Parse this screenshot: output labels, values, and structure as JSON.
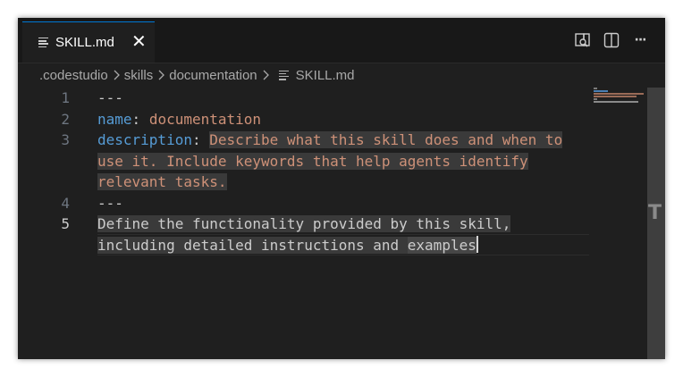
{
  "tab": {
    "label": "SKILL.md",
    "close_glyph": "✕",
    "icon": "markdown-file-icon"
  },
  "actions": [
    {
      "name": "open-preview-icon"
    },
    {
      "name": "split-editor-icon"
    },
    {
      "name": "more-actions-icon",
      "glyph": "···"
    }
  ],
  "breadcrumb": {
    "items": [
      ".codestudio",
      "skills",
      "documentation",
      "SKILL.md"
    ],
    "separator": ">"
  },
  "editor": {
    "line_numbers": [
      "1",
      "2",
      "3",
      "4",
      "5"
    ],
    "active_line": "5",
    "lines": {
      "l1": "---",
      "l2_key": "name",
      "l2_colon": ":",
      "l2_val": "documentation",
      "l3_key": "description",
      "l3_colon": ":",
      "l3_val_a": "Describe what this skill does and when to",
      "l3_val_b": "use it. Include keywords that help agents identify",
      "l3_val_c": "relevant tasks.",
      "l4": "---",
      "l5_a": "Define the functionality provided by this skill,",
      "l5_b_pre": "including detailed instructions and ",
      "l5_b_word": "examples"
    }
  },
  "scrollbar": {
    "glyph": "T"
  },
  "colors": {
    "background": "#1f1f1f",
    "tab_accent": "#0078d4",
    "yaml_key": "#569cd6",
    "yaml_value": "#ce9178",
    "text": "#cccccc"
  }
}
